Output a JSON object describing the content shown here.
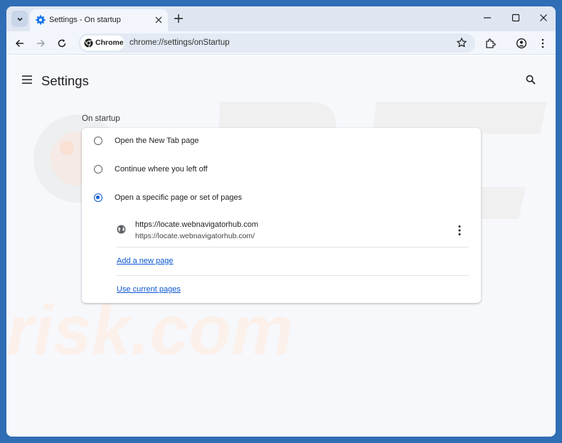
{
  "tab": {
    "title": "Settings - On startup"
  },
  "omnibox": {
    "chip_label": "Chrome",
    "url": "chrome://settings/onStartup"
  },
  "header": {
    "title": "Settings"
  },
  "section": {
    "title": "On startup"
  },
  "options": [
    {
      "label": "Open the New Tab page",
      "selected": false
    },
    {
      "label": "Continue where you left off",
      "selected": false
    },
    {
      "label": "Open a specific page or set of pages",
      "selected": true
    }
  ],
  "startup_page": {
    "title": "https://locate.webnavigatorhub.com",
    "url": "https://locate.webnavigatorhub.com/"
  },
  "links": {
    "add_page": "Add a new page",
    "use_current": "Use current pages"
  },
  "colors": {
    "accent": "#0b57d0",
    "desktop": "#2f6db5",
    "tabstrip": "#dfe6f2"
  },
  "watermark": "PC risk.com"
}
